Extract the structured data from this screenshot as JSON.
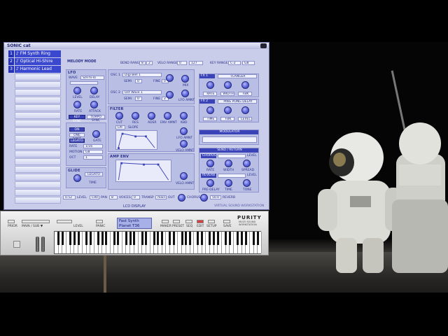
{
  "plugin": {
    "brand": "SONIC cat",
    "close_icon": "close-icon",
    "slots": [
      {
        "num": "1",
        "name": "♪ FM Synth Ring"
      },
      {
        "num": "2",
        "name": "♪ Optical Hi-Shire"
      },
      {
        "num": "3",
        "name": "♪ Harmonic Lead"
      }
    ],
    "melody_mode": "MELODY MODE",
    "bend_range": {
      "label": "BEND RANGE",
      "down": "8",
      "up": "2"
    },
    "velo_range": {
      "label": "VELO RANGE",
      "min": "0",
      "max": "127"
    },
    "key_range": {
      "label": "KEY RANGE",
      "low": "C-2",
      "high": "G8"
    },
    "lfo": {
      "title": "LFO",
      "wave_label": "WAVE",
      "wave_value": "S/H hi-lo",
      "knobs": [
        "LEVEL",
        "DELAY",
        "RATE",
        "ATTACK"
      ],
      "key_sync": "KEY SYNC",
      "tempo_sync": "TEMPO SYNC"
    },
    "osc1": {
      "label": "OSC 1",
      "value": "Digi Bell 1",
      "semi": "SEMI",
      "semi_val": "0",
      "fine": "FINE",
      "fine_val": "0"
    },
    "osc2": {
      "label": "OSC 2",
      "value": "Oct Wave 1",
      "semi": "SEMI",
      "semi_val": "0",
      "fine": "FINE",
      "fine_val": "2"
    },
    "osc_knobs": {
      "mix": "MIX",
      "lfo_amnt": "LFO AMNT"
    },
    "filter": {
      "title": "FILTER",
      "knobs": [
        "CUT",
        "RES",
        "ADSR",
        "ENV AMNT",
        "KBD"
      ],
      "type": "LPF",
      "slope": "SLOPE",
      "lfo_amnt": "LFO AMNT",
      "velo_amnt": "VELO AMNT"
    },
    "amp_env": {
      "title": "AMP ENV",
      "velo_amnt": "VELO AMNT"
    },
    "portamento": {
      "title": "PORTAMENTO",
      "buttons": [
        "ON",
        "ONE SHOT",
        "LEGATO"
      ],
      "rate_label": "RATE",
      "rate_value": "1/16",
      "motion_label": "MOTION",
      "motion_value": "G8",
      "oct_label": "OCT",
      "oct_value": "1",
      "gate": "GATE"
    },
    "glide": {
      "title": "GLIDE",
      "button": "LEGATO",
      "time": "TIME"
    },
    "fx1": {
      "title": "FX 1",
      "type": "FLANGER",
      "knobs": [
        "RATE",
        "WIDTH",
        "FBK"
      ]
    },
    "fx2": {
      "title": "FX 2",
      "type": "PING PONG DELAY",
      "knobs": [
        "TIME",
        "FBK",
        "LEVEL"
      ]
    },
    "modulator": {
      "title": "MODULATOR"
    },
    "send_return": {
      "title": "SEND / RETURN",
      "chorus": "CHORUS",
      "chorus_level": "LEVEL",
      "chorus_knobs": [
        "RATE",
        "WIDTH",
        "SPREAD"
      ],
      "reverb": "REVERB",
      "reverb_level": "LEVEL",
      "reverb_knobs": [
        "PRE-DELAY",
        "TIME",
        "TONE"
      ]
    },
    "bottom": {
      "level_value": "0.52",
      "level": "LEVEL",
      "c90": "C90",
      "pan": "PAN",
      "voices_value": "8",
      "voices": "VOICES",
      "transp_value": "0",
      "transp": "TRANSP",
      "out_value": "main",
      "out": "OUT",
      "chorus": "CHORUS",
      "reverb_value": "50.0",
      "reverb": "REVERB"
    },
    "lcd_display": "LCD DISPLAY",
    "footer": "VIRTUAL SOUND WORKSTATION"
  },
  "keyboard": {
    "prior": "PRIOR",
    "main_sub": "MAIN / SUB ▼",
    "level": "LEVEL",
    "panic": "PANIC",
    "lcd_line1": "Fast Synth",
    "lcd_line2": "Planet T36",
    "buttons": [
      "MAKER",
      "PRESET",
      "SEQ",
      "EDIT",
      "SETUP",
      "SAVE"
    ],
    "brand": "PURITY",
    "brand_sub": "MULTI SOUND WORKSTATION"
  }
}
